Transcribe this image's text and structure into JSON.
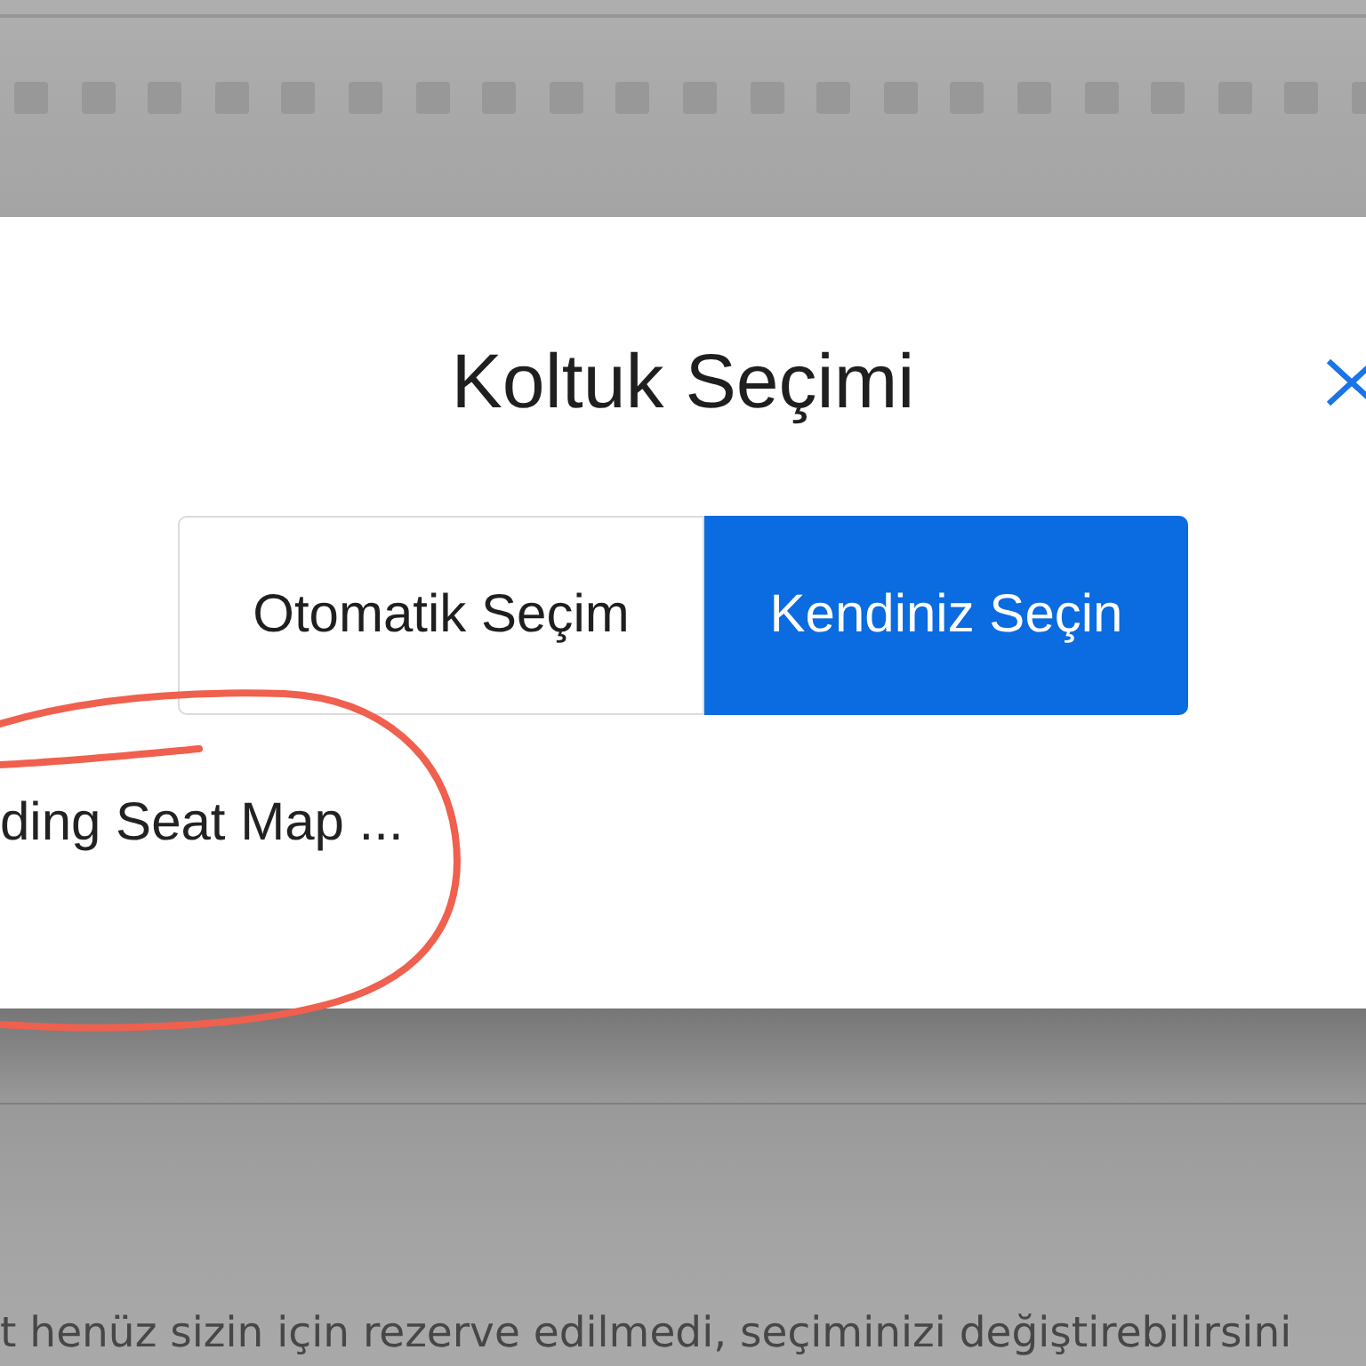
{
  "modal": {
    "title": "Koltuk Seçimi",
    "tabs": [
      {
        "label": "Otomatik Seçim",
        "selected": false
      },
      {
        "label": "Kendiniz Seçin",
        "selected": true
      }
    ],
    "loading_text": "ding Seat Map ..."
  },
  "background_text": "t henüz sizin için rezerve edilmedi, seçiminizi değiştirebilirsini"
}
